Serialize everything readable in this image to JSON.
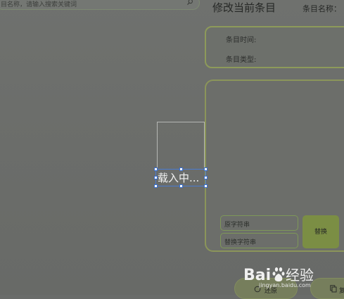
{
  "search": {
    "placeholder": "目名称，请输入搜索关键词"
  },
  "header": {
    "title": "修改当前条目",
    "entry_name_label": "条目名称："
  },
  "info": {
    "time_label": "条目时间:",
    "type_label": "条目类型:"
  },
  "replace": {
    "find_placeholder": "原字符串",
    "replace_placeholder": "替换字符串",
    "button_label": "替换"
  },
  "actions": {
    "restore_label": "还原",
    "copy_label": "复"
  },
  "loading": {
    "text": "载入中..."
  },
  "watermark": {
    "brand": "Baidu经验",
    "url": "jingyan.baidu.com"
  },
  "colors": {
    "accent_green": "#8d9a5a",
    "selection_blue": "#3a6fcf"
  }
}
